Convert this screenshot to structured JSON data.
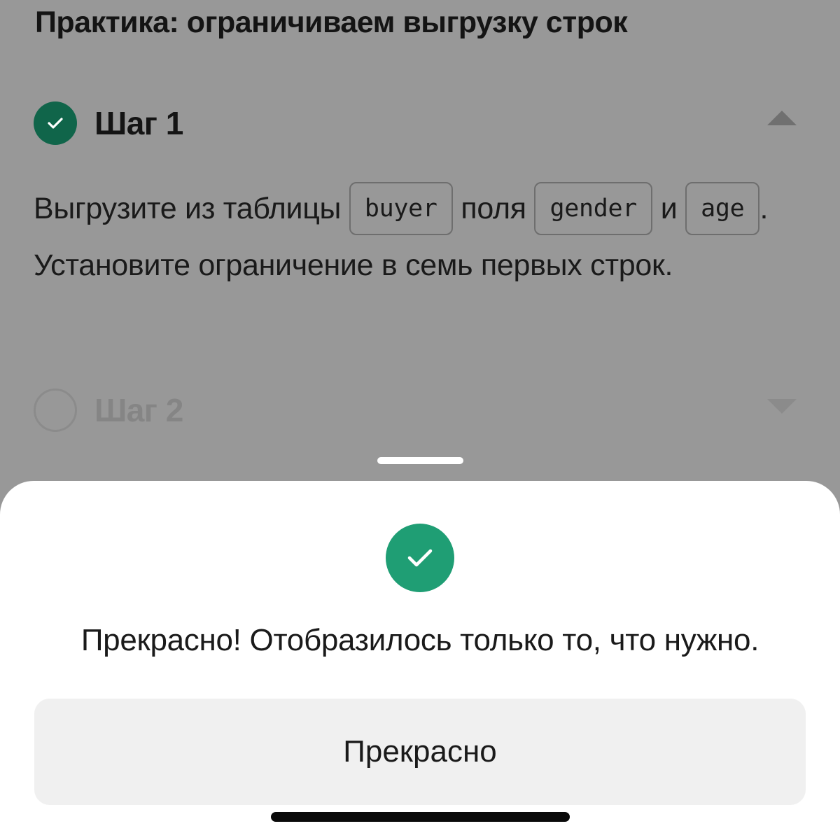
{
  "page": {
    "title": "Практика: ограничиваем выгрузку строк"
  },
  "steps": [
    {
      "label": "Шаг 1",
      "status": "completed",
      "expanded": true,
      "text": {
        "part1": "Выгрузите из таблицы",
        "code1": "buyer",
        "part2": "поля",
        "code2": "gender",
        "part3": "и",
        "code3": "age",
        "part4": ". Установите ограничение в семь первых строк."
      }
    },
    {
      "label": "Шаг 2",
      "status": "pending",
      "expanded": false
    }
  ],
  "sheet": {
    "message": "Прекрасно! Отобразилось только то, что нужно.",
    "button_label": "Прекрасно"
  },
  "colors": {
    "overlay": "#989898",
    "step_check": "#10654a",
    "success": "#1f9e74",
    "button_bg": "#f0f0f0"
  },
  "icons": {
    "step1": "check-circle-icon",
    "step1_toggle": "chevron-up-icon",
    "step2": "empty-circle-icon",
    "step2_toggle": "chevron-down-icon",
    "success": "check-circle-icon"
  }
}
